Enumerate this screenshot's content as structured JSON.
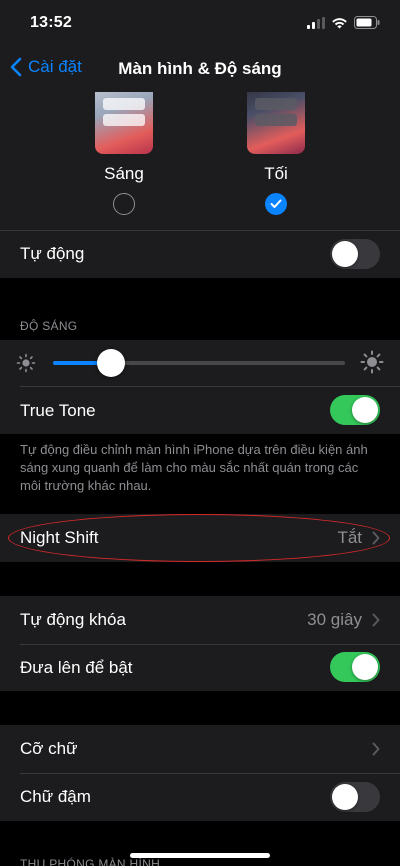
{
  "status": {
    "time": "13:52"
  },
  "nav": {
    "back_label": "Cài đặt",
    "title": "Màn hình & Độ sáng"
  },
  "appearance": {
    "light_label": "Sáng",
    "dark_label": "Tối",
    "selected": "dark"
  },
  "auto": {
    "label": "Tự động",
    "enabled": false
  },
  "brightness": {
    "header": "ĐỘ SÁNG",
    "level": 0.2
  },
  "true_tone": {
    "label": "True Tone",
    "enabled": true,
    "footnote": "Tự động điều chỉnh màn hình iPhone dựa trên điều kiện ánh sáng xung quanh để làm cho màu sắc nhất quán trong các môi trường khác nhau."
  },
  "night_shift": {
    "label": "Night Shift",
    "value": "Tắt"
  },
  "auto_lock": {
    "label": "Tự động khóa",
    "value": "30 giây"
  },
  "raise_to_wake": {
    "label": "Đưa lên để bật",
    "enabled": true
  },
  "text_size": {
    "label": "Cỡ chữ"
  },
  "bold_text": {
    "label": "Chữ đậm",
    "enabled": false
  },
  "zoom": {
    "header": "THU PHÓNG MÀN HÌNH"
  },
  "colors": {
    "accent": "#0a84ff",
    "toggle_on": "#34c759",
    "annotation": "#d42a2a"
  }
}
